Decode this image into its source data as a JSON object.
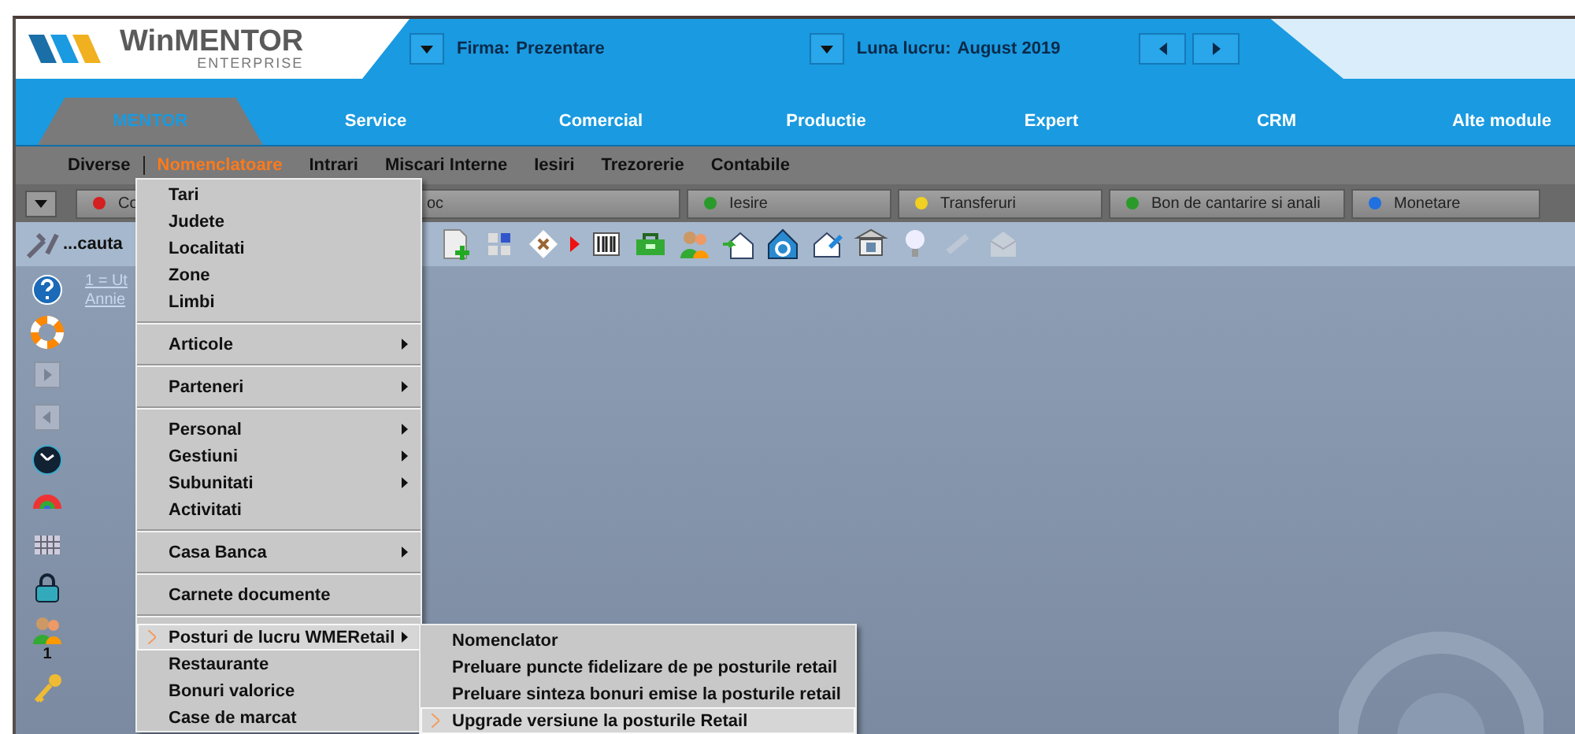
{
  "header": {
    "logo": {
      "name": "WinMENTOR",
      "edition": "ENTERPRISE"
    },
    "company": {
      "label": "Firma:",
      "value": "Prezentare"
    },
    "month": {
      "label": "Luna lucru:",
      "value": "August 2019"
    }
  },
  "modules": [
    {
      "label": "MENTOR",
      "selected": true
    },
    {
      "label": "Service",
      "selected": false
    },
    {
      "label": "Comercial",
      "selected": false
    },
    {
      "label": "Productie",
      "selected": false
    },
    {
      "label": "Expert",
      "selected": false
    },
    {
      "label": "CRM",
      "selected": false
    },
    {
      "label": "Alte module",
      "selected": false
    }
  ],
  "menu_bar": [
    {
      "label": "Diverse",
      "selected": false
    },
    {
      "label": "Nomenclatoare",
      "selected": true
    },
    {
      "label": "Intrari",
      "selected": false
    },
    {
      "label": "Miscari Interne",
      "selected": false
    },
    {
      "label": "Iesiri",
      "selected": false
    },
    {
      "label": "Trezorerie",
      "selected": false
    },
    {
      "label": "Contabile",
      "selected": false
    }
  ],
  "quick_tabs": [
    {
      "label": "Co",
      "color": "#d42020"
    },
    {
      "label": "oc"
    },
    {
      "label": "Iesire",
      "color": "#2a9a2a"
    },
    {
      "label": "Transferuri",
      "color": "#f0d020"
    },
    {
      "label": "Bon de cantarire si anali",
      "color": "#2a9a2a"
    },
    {
      "label": "Monetare",
      "color": "#2070e0"
    }
  ],
  "search": {
    "placeholder": "...cauta"
  },
  "sidebar": {
    "links": [
      "1 = Ut",
      "Annie"
    ],
    "users_count": "1"
  },
  "dropdown": {
    "groups": [
      [
        {
          "label": "Tari",
          "submenu": false,
          "selected": false
        },
        {
          "label": "Judete",
          "submenu": false,
          "selected": false
        },
        {
          "label": "Localitati",
          "submenu": false,
          "selected": false
        },
        {
          "label": "Zone",
          "submenu": false,
          "selected": false
        },
        {
          "label": "Limbi",
          "submenu": false,
          "selected": false
        }
      ],
      [
        {
          "label": "Articole",
          "submenu": true,
          "selected": false
        }
      ],
      [
        {
          "label": "Parteneri",
          "submenu": true,
          "selected": false
        }
      ],
      [
        {
          "label": "Personal",
          "submenu": true,
          "selected": false
        },
        {
          "label": "Gestiuni",
          "submenu": true,
          "selected": false
        },
        {
          "label": "Subunitati",
          "submenu": true,
          "selected": false
        },
        {
          "label": "Activitati",
          "submenu": false,
          "selected": false
        }
      ],
      [
        {
          "label": "Casa  Banca",
          "submenu": true,
          "selected": false
        }
      ],
      [
        {
          "label": "Carnete documente",
          "submenu": false,
          "selected": false
        }
      ],
      [
        {
          "label": "Posturi de lucru WMERetail",
          "submenu": true,
          "selected": true
        },
        {
          "label": "Restaurante",
          "submenu": false,
          "selected": false
        },
        {
          "label": "Bonuri valorice",
          "submenu": false,
          "selected": false
        },
        {
          "label": "Case de marcat",
          "submenu": false,
          "selected": false
        }
      ]
    ]
  },
  "submenu": [
    {
      "label": "Nomenclator",
      "selected": false
    },
    {
      "label": "Preluare puncte fidelizare de pe posturile retail",
      "selected": false
    },
    {
      "label": "Preluare sinteza bonuri emise la posturile retail",
      "selected": false
    },
    {
      "label": "Upgrade versiune la posturile Retail",
      "selected": true
    }
  ]
}
